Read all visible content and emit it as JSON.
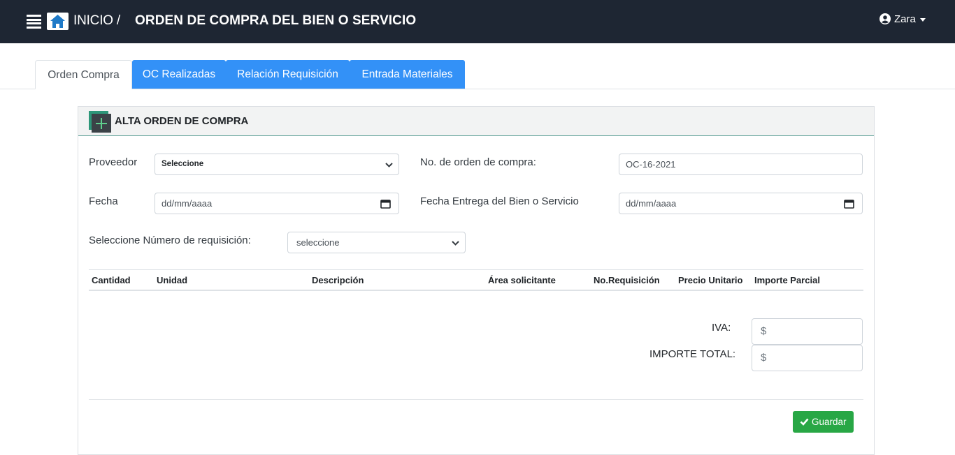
{
  "navbar": {
    "breadcrumb_home": "INICIO /",
    "page_title": "ORDEN DE COMPRA DEL BIEN O SERVICIO",
    "user_name": "Zara",
    "bg_color": "#1e2633"
  },
  "tabs": [
    {
      "label": "Orden Compra",
      "active": true
    },
    {
      "label": "OC Realizadas",
      "active": false
    },
    {
      "label": "Relación Requisición",
      "active": false
    },
    {
      "label": "Entrada Materiales",
      "active": false
    }
  ],
  "card": {
    "title": "ALTA ORDEN DE COMPRA"
  },
  "form": {
    "proveedor_label": "Proveedor",
    "proveedor_value": "Seleccione",
    "orden_label": "No. de orden de compra:",
    "orden_value": "OC-16-2021",
    "fecha_label": "Fecha",
    "fecha_placeholder": "dd/mm/aaaa",
    "fecha_entrega_label": "Fecha Entrega del Bien o Servicio",
    "fecha_entrega_placeholder": "dd/mm/aaaa",
    "requisicion_label": "Seleccione Número de requisición:",
    "requisicion_value": "seleccione"
  },
  "table": {
    "columns": [
      "Cantidad",
      "Unidad",
      "Descripción",
      "Área solicitante",
      "No.Requisición",
      "Precio Unitario",
      "Importe Parcial"
    ],
    "rows": []
  },
  "totals": {
    "iva_label": "IVA:",
    "iva_placeholder": "$",
    "total_label": "IMPORTE TOTAL:",
    "total_placeholder": "$"
  },
  "actions": {
    "save_label": "Guardar"
  },
  "colors": {
    "tab_blue": "#3391f7",
    "save_green": "#28a745"
  }
}
